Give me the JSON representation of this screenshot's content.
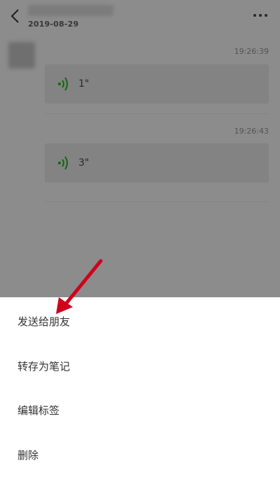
{
  "header": {
    "date": "2019-08-29"
  },
  "messages": [
    {
      "time": "19:26:39",
      "duration": "1\""
    },
    {
      "time": "19:26:43",
      "duration": "3\""
    }
  ],
  "action_sheet": {
    "items": [
      {
        "label": "发送给朋友"
      },
      {
        "label": "转存为笔记"
      },
      {
        "label": "编辑标签"
      },
      {
        "label": "删除"
      }
    ]
  },
  "colors": {
    "voice_icon": "#1aad19",
    "arrow": "#d0021b"
  },
  "icons": {
    "back": "back-arrow-icon",
    "more": "more-dots-icon",
    "voice": "voice-wave-icon"
  }
}
